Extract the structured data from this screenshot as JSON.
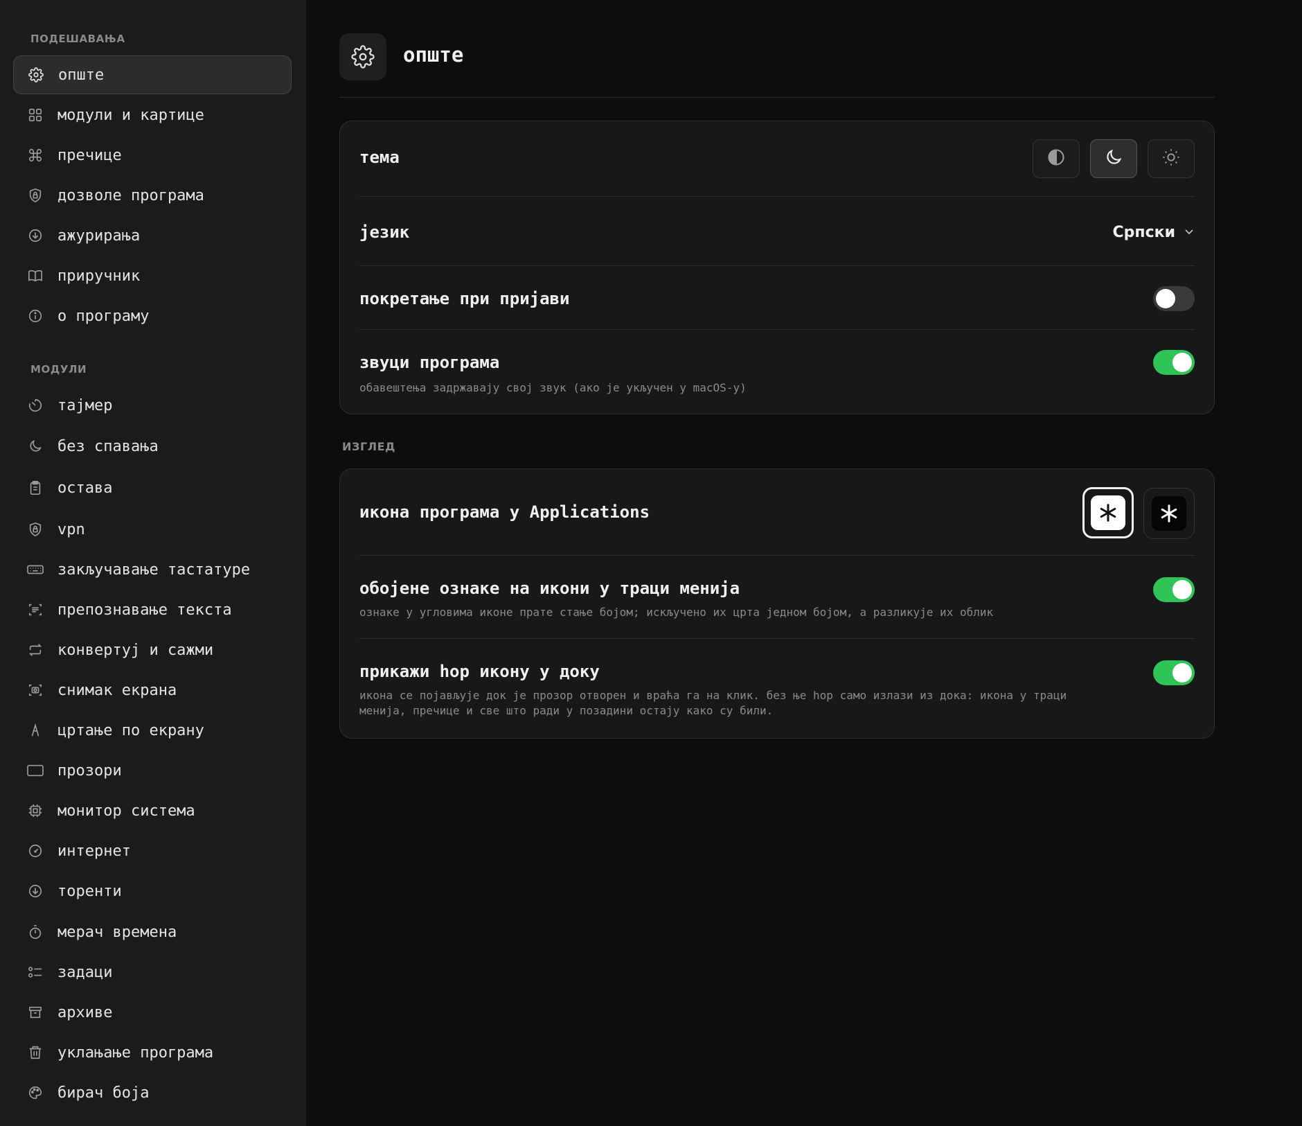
{
  "sidebar": {
    "section_settings": "ПОДЕШАВАЊА",
    "settings_items": [
      {
        "label": "опште",
        "icon": "gear-icon",
        "active": true
      },
      {
        "label": "модули и картице",
        "icon": "grid-icon"
      },
      {
        "label": "пречице",
        "icon": "command-icon"
      },
      {
        "label": "дозволе програма",
        "icon": "shield-lock-icon"
      },
      {
        "label": "ажурирања",
        "icon": "download-circle-icon"
      },
      {
        "label": "приручник",
        "icon": "book-icon"
      },
      {
        "label": "о програму",
        "icon": "info-icon"
      }
    ],
    "section_modules": "МОДУЛИ",
    "module_items": [
      {
        "label": "тајмер",
        "icon": "timer-icon"
      },
      {
        "label": "без спавања",
        "icon": "moon-icon"
      },
      {
        "label": "остава",
        "icon": "clipboard-icon"
      },
      {
        "label": "vpn",
        "icon": "shield-lock-icon"
      },
      {
        "label": "закључавање тастатуре",
        "icon": "keyboard-icon"
      },
      {
        "label": "препознавање текста",
        "icon": "text-scan-icon"
      },
      {
        "label": "конвертуј и сажми",
        "icon": "convert-icon"
      },
      {
        "label": "снимак екрана",
        "icon": "screenshot-icon"
      },
      {
        "label": "цртање по екрану",
        "icon": "pen-icon"
      },
      {
        "label": "прозори",
        "icon": "window-icon"
      },
      {
        "label": "монитор система",
        "icon": "cpu-icon"
      },
      {
        "label": "интернет",
        "icon": "speedometer-icon"
      },
      {
        "label": "торенти",
        "icon": "download-circle-icon"
      },
      {
        "label": "мерач времена",
        "icon": "stopwatch-icon"
      },
      {
        "label": "задаци",
        "icon": "tasks-icon"
      },
      {
        "label": "архиве",
        "icon": "archive-icon"
      },
      {
        "label": "уклањање програма",
        "icon": "trash-icon"
      },
      {
        "label": "бирач боја",
        "icon": "palette-icon"
      }
    ]
  },
  "header": {
    "title": "опште",
    "icon": "gear-icon"
  },
  "general": {
    "theme_label": "тема",
    "theme_options": [
      "auto",
      "dark",
      "light"
    ],
    "theme_selected": "dark",
    "language_label": "језик",
    "language_value": "Српски",
    "login_label": "покретање при пријави",
    "login_enabled": false,
    "sounds_label": "звуци програма",
    "sounds_sub": "обавештења задржавају свој звук (ако је укључен у macOS-у)",
    "sounds_enabled": true
  },
  "appearance": {
    "section_label": "ИЗГЛЕД",
    "app_icon_label": "икона програма у Applications",
    "app_icon_selected": "light",
    "colored_label": "обојене ознаке на икони у траци менија",
    "colored_sub": "ознаке у угловима иконе прате стање бојом; искључено их црта једном бојом, а разликује их облик",
    "colored_enabled": true,
    "dock_label": "прикажи hop икону у доку",
    "dock_sub": "икона се појављује док је прозор отворен и враћа га на клик. без ње hop само излази из дока: икона у траци\nменија, пречице и све што ради у позадини остају како су били.",
    "dock_enabled": true
  },
  "colors": {
    "accent_green": "#2fc457",
    "background": "#0d0d0d",
    "sidebar": "#1b1b1b"
  }
}
